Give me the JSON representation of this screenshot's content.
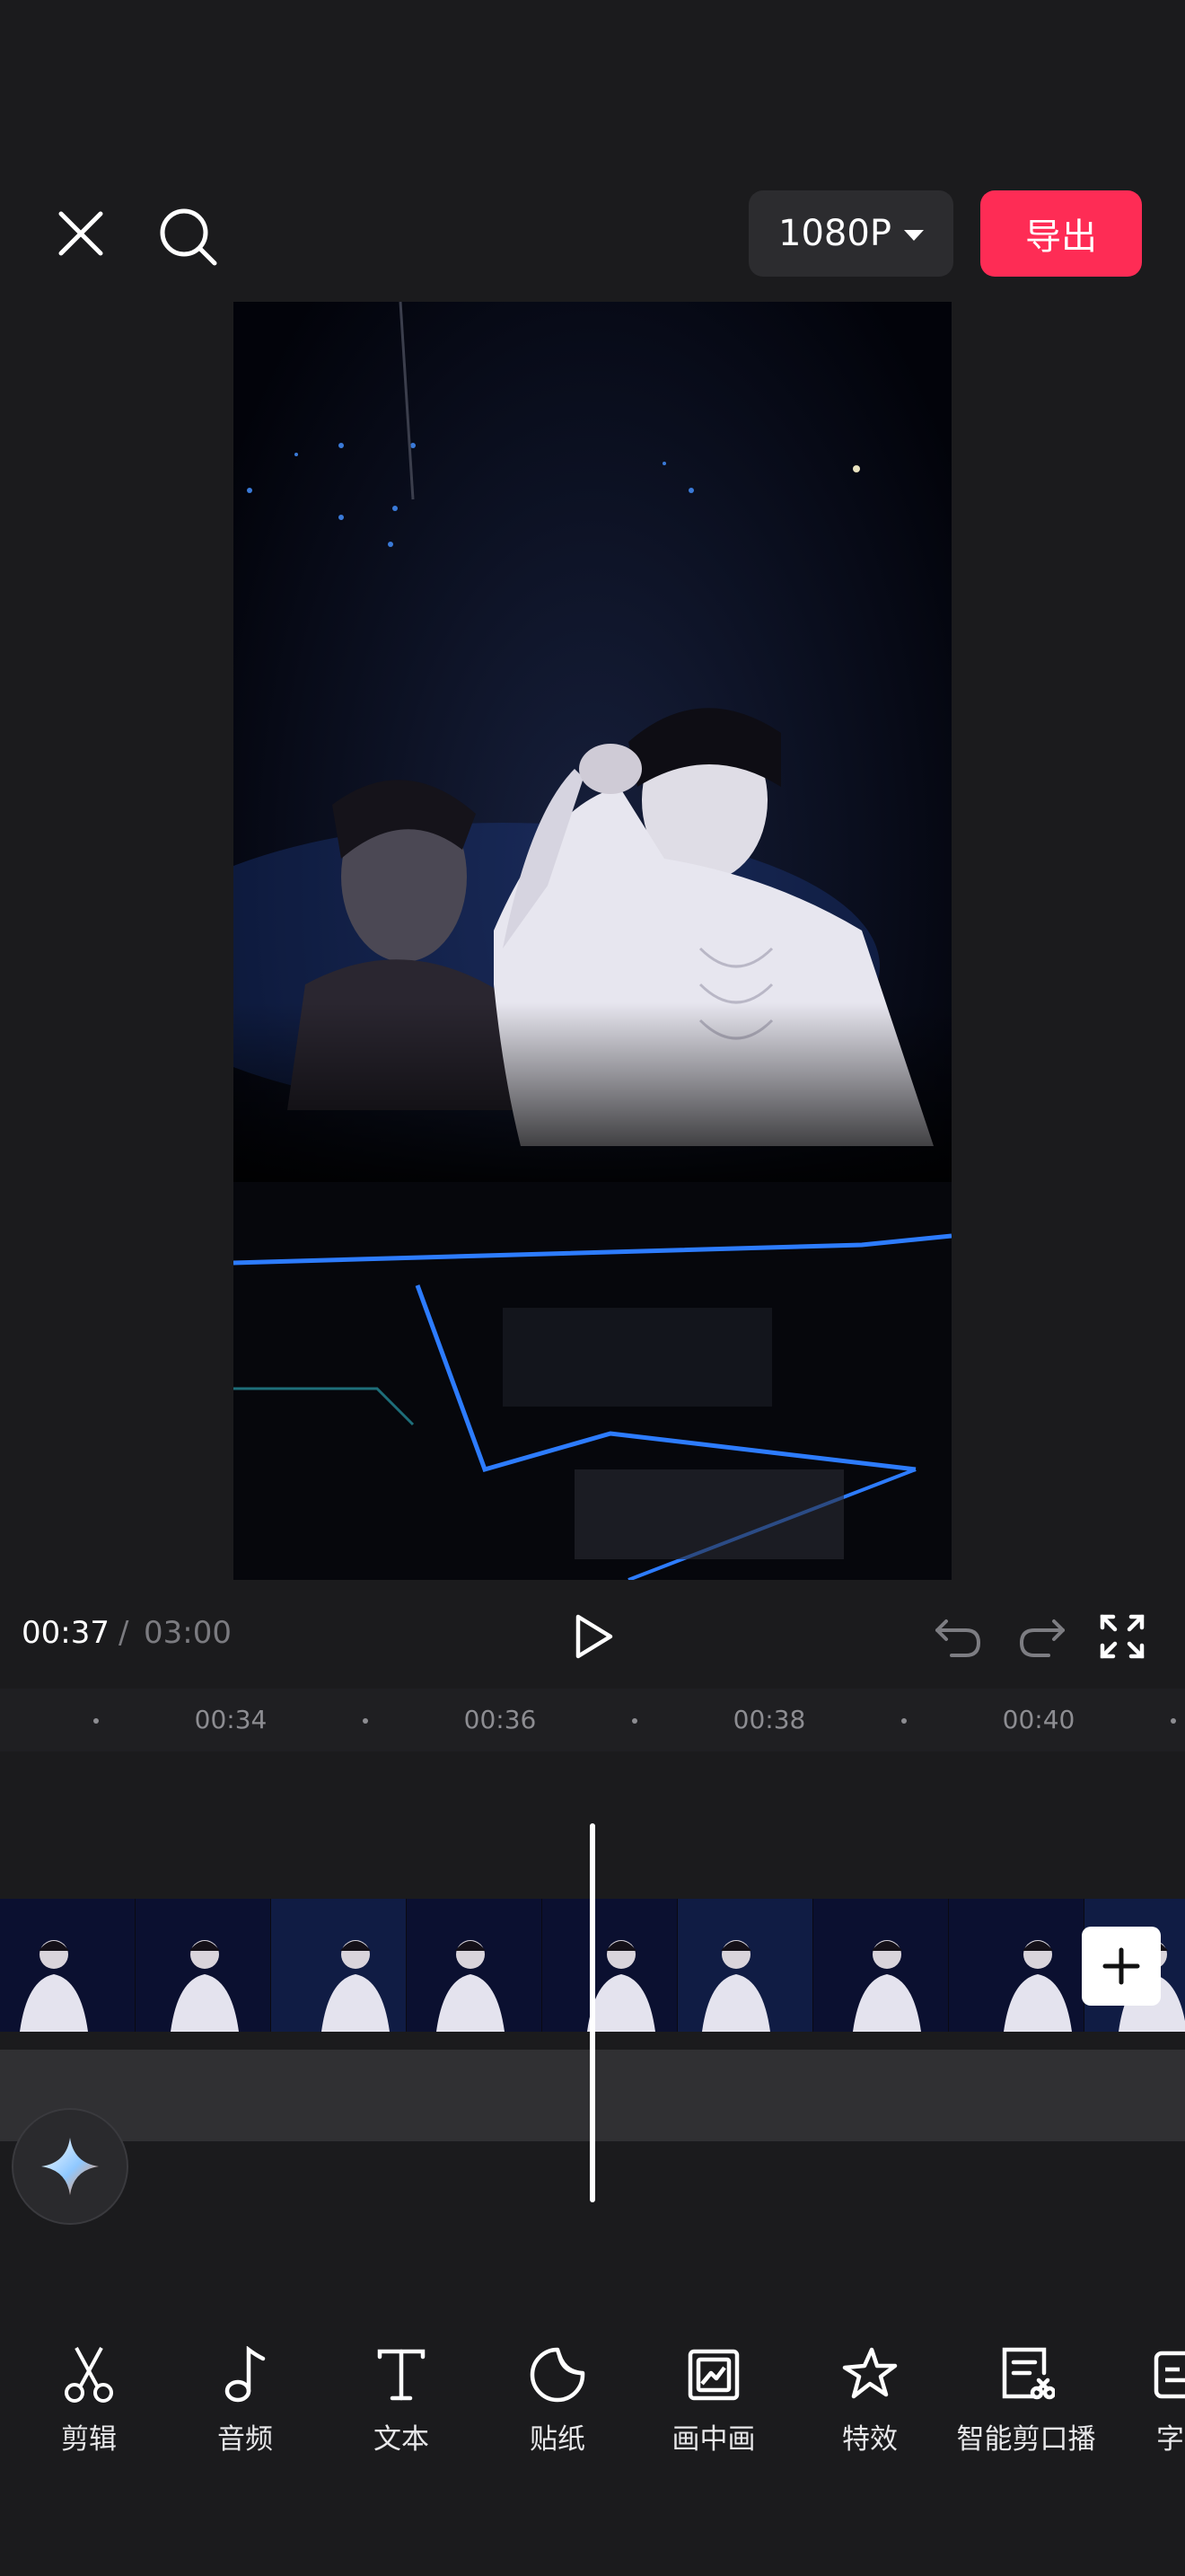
{
  "header": {
    "resolution_label": "1080P",
    "export_label": "导出"
  },
  "playback": {
    "current_time": "00:37",
    "separator": "/",
    "total_time": "03:00"
  },
  "timeline": {
    "ruler_labels": [
      "00:34",
      "00:36",
      "00:38",
      "00:40"
    ]
  },
  "toolbar": {
    "items": [
      {
        "label": "剪辑",
        "icon": "scissors-icon"
      },
      {
        "label": "音频",
        "icon": "music-note-icon"
      },
      {
        "label": "文本",
        "icon": "text-icon"
      },
      {
        "label": "贴纸",
        "icon": "sticker-icon"
      },
      {
        "label": "画中画",
        "icon": "picture-in-picture-icon"
      },
      {
        "label": "特效",
        "icon": "effects-star-icon"
      },
      {
        "label": "智能剪口播",
        "icon": "smart-cut-icon"
      },
      {
        "label": "字幕",
        "icon": "captions-icon"
      }
    ]
  },
  "colors": {
    "accent": "#fe2c55",
    "background": "#1b1b1d"
  }
}
